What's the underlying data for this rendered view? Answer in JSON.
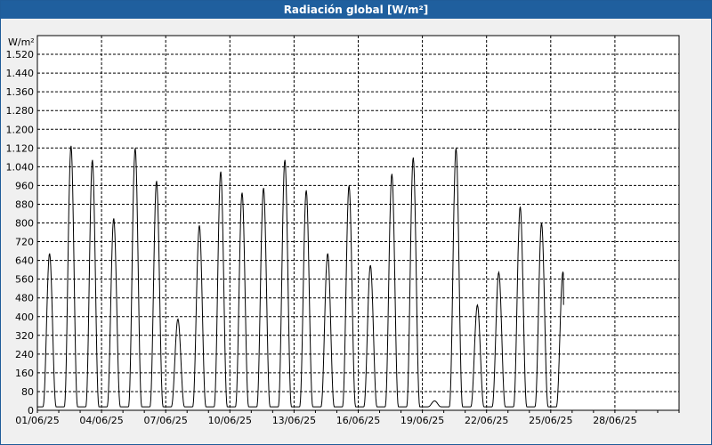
{
  "window": {
    "title": "Radiación global [W/m²]"
  },
  "colors": {
    "titlebar": "#1f5f9e",
    "line": "#000000",
    "grid": "#000000",
    "background": "#ffffff"
  },
  "chart_data": {
    "type": "line",
    "title": "Radiación global [W/m²]",
    "ylabel": "W/m²",
    "xlabel": "",
    "ylim": [
      0,
      1600
    ],
    "xlim": [
      "2025-06-01",
      "2025-07-01"
    ],
    "y_ticks": [
      "0",
      "80",
      "160",
      "240",
      "320",
      "400",
      "480",
      "560",
      "640",
      "720",
      "800",
      "880",
      "960",
      "1.040",
      "1.120",
      "1.200",
      "1.280",
      "1.360",
      "1.440",
      "1.520"
    ],
    "x_ticks": [
      "01/06/25",
      "04/06/25",
      "07/06/25",
      "10/06/25",
      "13/06/25",
      "16/06/25",
      "19/06/25",
      "22/06/25",
      "25/06/25",
      "28/06/25"
    ],
    "grid": true,
    "series": [
      {
        "daily_peaks": [
          {
            "date": "2025-06-01",
            "peak": 670
          },
          {
            "date": "2025-06-02",
            "peak": 1130
          },
          {
            "date": "2025-06-03",
            "peak": 1070
          },
          {
            "date": "2025-06-04",
            "peak": 820
          },
          {
            "date": "2025-06-05",
            "peak": 1120
          },
          {
            "date": "2025-06-06",
            "peak": 980
          },
          {
            "date": "2025-06-07",
            "peak": 390
          },
          {
            "date": "2025-06-08",
            "peak": 790
          },
          {
            "date": "2025-06-09",
            "peak": 1020
          },
          {
            "date": "2025-06-10",
            "peak": 930
          },
          {
            "date": "2025-06-11",
            "peak": 950
          },
          {
            "date": "2025-06-12",
            "peak": 1070
          },
          {
            "date": "2025-06-13",
            "peak": 940
          },
          {
            "date": "2025-06-14",
            "peak": 670
          },
          {
            "date": "2025-06-15",
            "peak": 960
          },
          {
            "date": "2025-06-16",
            "peak": 620
          },
          {
            "date": "2025-06-17",
            "peak": 1010
          },
          {
            "date": "2025-06-18",
            "peak": 1080
          },
          {
            "date": "2025-06-19",
            "peak": 40
          },
          {
            "date": "2025-06-20",
            "peak": 1120
          },
          {
            "date": "2025-06-21",
            "peak": 450
          },
          {
            "date": "2025-06-22",
            "peak": 590
          },
          {
            "date": "2025-06-23",
            "peak": 870
          },
          {
            "date": "2025-06-24",
            "peak": 800
          },
          {
            "date": "2025-06-25",
            "peak": 590
          }
        ],
        "end_value": 450
      }
    ]
  }
}
